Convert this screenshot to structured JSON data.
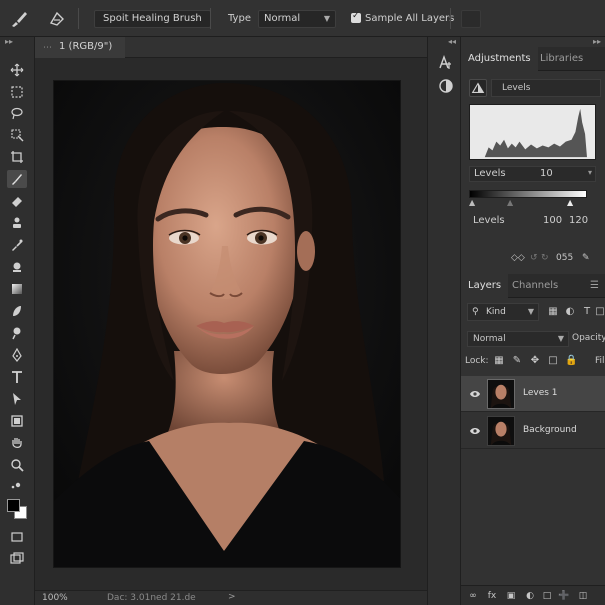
{
  "options_bar": {
    "tool_name": "Spoit Healing Brush",
    "type_label": "Type",
    "type_value": "Normal",
    "sample_all_layers_label": "Sample All Layers"
  },
  "document": {
    "tab_title": "1 (RGB/9\")"
  },
  "status": {
    "zoom": "100%",
    "doc_info": "Dac: 3.01ned 21.de",
    "arrow": ">"
  },
  "panels": {
    "adjustments_tab": "Adjustments",
    "libraries_tab": "Libraries",
    "adjustment_name": "Levels",
    "levels_label_1": "Levels",
    "levels_value_1": "10",
    "levels_label_2": "Levels",
    "levels_value_2a": "100",
    "levels_value_2b": "120",
    "footer_value": "055",
    "layers_tab": "Layers",
    "channels_tab": "Channels",
    "kind_label": "Kind",
    "blend_mode": "Normal",
    "opacity_label": "Opacity",
    "lock_label": "Lock:",
    "fill_label": "Filli",
    "layers": [
      {
        "name": "Leves 1",
        "selected": true
      },
      {
        "name": "Background",
        "selected": false
      }
    ]
  },
  "colors": {
    "ui_dark": "#282828",
    "panel": "#323232",
    "selected_layer": "#454545"
  }
}
